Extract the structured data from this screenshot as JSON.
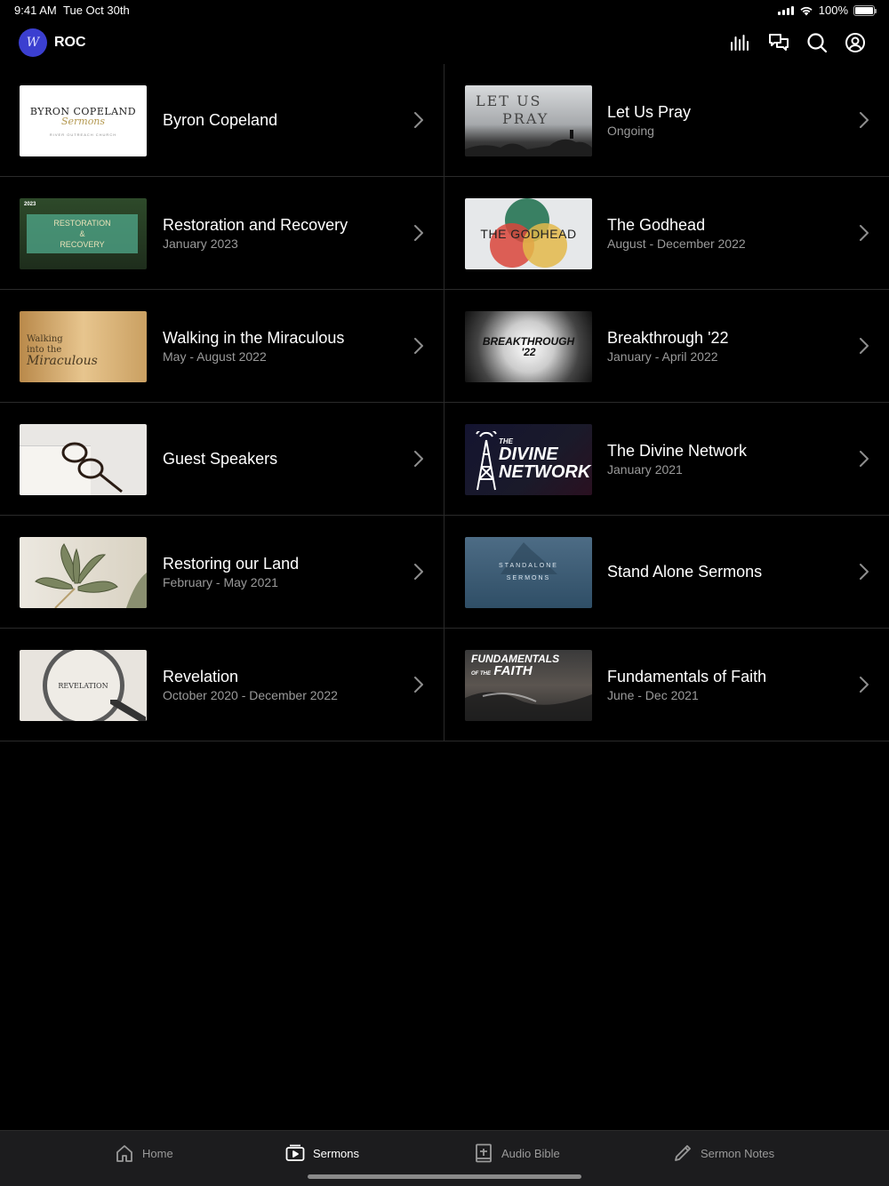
{
  "status_bar": {
    "time": "9:41 AM",
    "date": "Tue Oct 30th",
    "battery": "100%",
    "battery_level": 1.0
  },
  "header": {
    "logo_text": "W",
    "title": "ROC",
    "icons": [
      "equalizer-icon",
      "chat-icon",
      "search-icon",
      "account-icon"
    ]
  },
  "series": [
    {
      "title": "Byron Copeland",
      "subtitle": "",
      "thumb": {
        "line1": "BYRON COPELAND",
        "line2": "Sermons",
        "line3": "RIVER OUTREACH CHURCH"
      }
    },
    {
      "title": "Let Us Pray",
      "subtitle": "Ongoing",
      "thumb": {
        "line1": "LET US",
        "line2": "PRAY"
      }
    },
    {
      "title": "Restoration and Recovery",
      "subtitle": "January 2023",
      "thumb": {
        "line1": "2023",
        "line2": "RESTORATION",
        "line3": "&",
        "line4": "RECOVERY"
      }
    },
    {
      "title": "The Godhead",
      "subtitle": "August - December 2022",
      "thumb": {
        "line1": "THE GODHEAD"
      }
    },
    {
      "title": "Walking in the Miraculous",
      "subtitle": "May - August 2022",
      "thumb": {
        "line1": "Walking",
        "line2": "into the",
        "line3": "Miraculous"
      }
    },
    {
      "title": "Breakthrough '22",
      "subtitle": "January - April 2022",
      "thumb": {
        "line1": "BREAKTHROUGH",
        "line2": "'22"
      }
    },
    {
      "title": "Guest Speakers",
      "subtitle": "",
      "thumb": {}
    },
    {
      "title": "The Divine Network",
      "subtitle": "January 2021",
      "thumb": {
        "line1": "THE",
        "line2": "DIVINE",
        "line3": "NETWORK"
      }
    },
    {
      "title": "Restoring our Land",
      "subtitle": "February - May 2021",
      "thumb": {}
    },
    {
      "title": "Stand Alone Sermons",
      "subtitle": "",
      "thumb": {
        "line1": "STANDALONE",
        "line2": "SERMONS"
      }
    },
    {
      "title": "Revelation",
      "subtitle": "October 2020 - December 2022",
      "thumb": {
        "line1": "REVELATION"
      }
    },
    {
      "title": "Fundamentals of Faith",
      "subtitle": "June - Dec 2021",
      "thumb": {
        "line1": "FUNDAMENTALS",
        "line2": "OF THE",
        "line3": "FAITH"
      }
    }
  ],
  "tabs": [
    {
      "label": "Home",
      "icon": "house-icon",
      "active": false
    },
    {
      "label": "Sermons",
      "icon": "play-window-icon",
      "active": true
    },
    {
      "label": "Audio Bible",
      "icon": "bible-icon",
      "active": false
    },
    {
      "label": "Sermon Notes",
      "icon": "pencil-icon",
      "active": false
    }
  ]
}
